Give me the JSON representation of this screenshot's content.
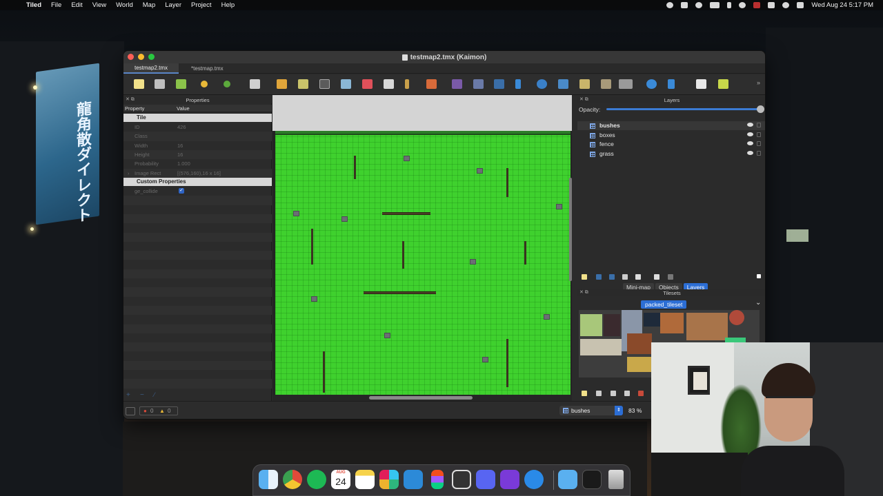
{
  "menubar": {
    "app_name": "Tiled",
    "menus": [
      "File",
      "Edit",
      "View",
      "World",
      "Map",
      "Layer",
      "Project",
      "Help"
    ],
    "clock": "Wed Aug 24  5:17 PM"
  },
  "window": {
    "title": "testmap2.tmx (Kaimon)",
    "tabs": [
      "testmap2.tmx",
      "*testmap.tmx"
    ]
  },
  "properties_panel": {
    "title": "Properties",
    "col_property": "Property",
    "col_value": "Value",
    "group_tile": "Tile",
    "rows": [
      {
        "key": "ID",
        "value": "426"
      },
      {
        "key": "Class",
        "value": ""
      },
      {
        "key": "Width",
        "value": "16"
      },
      {
        "key": "Height",
        "value": "16"
      },
      {
        "key": "Probability",
        "value": "1.000"
      },
      {
        "key": "Image Rect",
        "value": "[(576,160),16 x 16]"
      }
    ],
    "group_custom": "Custom Properties",
    "custom_rows": [
      {
        "key": "ge_collide",
        "value": "checked"
      }
    ],
    "footer_icons": [
      "plus-icon",
      "minus-icon",
      "edit-icon"
    ]
  },
  "layers_panel": {
    "title": "Layers",
    "opacity_label": "Opacity:",
    "opacity_value": 1.0,
    "layers": [
      {
        "name": "bushes",
        "selected": true,
        "visible": true
      },
      {
        "name": "boxes",
        "selected": false,
        "visible": true
      },
      {
        "name": "fence",
        "selected": false,
        "visible": true
      },
      {
        "name": "grass",
        "selected": false,
        "visible": true
      }
    ],
    "tabs": [
      "Mini-map",
      "Objects",
      "Layers"
    ],
    "active_tab": "Layers"
  },
  "tileset_panel": {
    "title": "Tilesets",
    "tileset_name": "packed_tileset"
  },
  "statusbar": {
    "error_count": "0",
    "warning_count": "0",
    "current_layer": "bushes",
    "zoom": "83 %"
  },
  "colors": {
    "accent": "#2c6ed5",
    "grass": "#3fd12e",
    "close": "#fe5f57",
    "minimize": "#febc2e",
    "maximize": "#28c840"
  },
  "dock": {
    "apps": [
      "finder-icon",
      "chrome-icon",
      "spotify-icon",
      "calendar-icon",
      "notes-icon",
      "slack-icon",
      "vscode-icon",
      "figma-icon",
      "claquette-icon",
      "discord-icon",
      "tableplus-icon",
      "teleport-icon",
      "downloads-icon",
      "activity-monitor-icon",
      "trash-icon"
    ],
    "calendar_month": "AUG",
    "calendar_day": "24"
  }
}
